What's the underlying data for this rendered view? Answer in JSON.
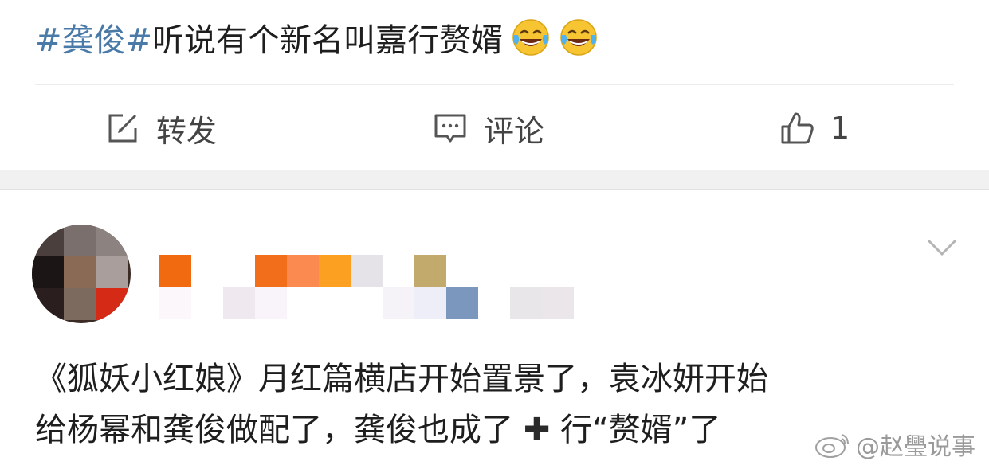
{
  "post": {
    "hashtag": "#龚俊#",
    "text": "听说有个新名叫嘉行赘婿",
    "emojis": [
      "laugh-tears-emoji",
      "laugh-tears-emoji"
    ]
  },
  "actions": {
    "repost_label": "转发",
    "comment_label": "评论",
    "like_count": "1"
  },
  "comment": {
    "line1": "《狐妖小红娘》月红篇横店开始置景了，袁冰妍开始",
    "line2_part1": "给杨幂和龚俊做配了，龚俊也成了",
    "plus_symbol": "✚",
    "line2_part2": "行“赘婿”了"
  },
  "watermark": {
    "text": "@赵璺说事"
  },
  "colors": {
    "hashtag": "#4a7aa8",
    "divider": "#ececec",
    "section_gap": "#f1f1f1",
    "icon_stroke": "#555555"
  }
}
